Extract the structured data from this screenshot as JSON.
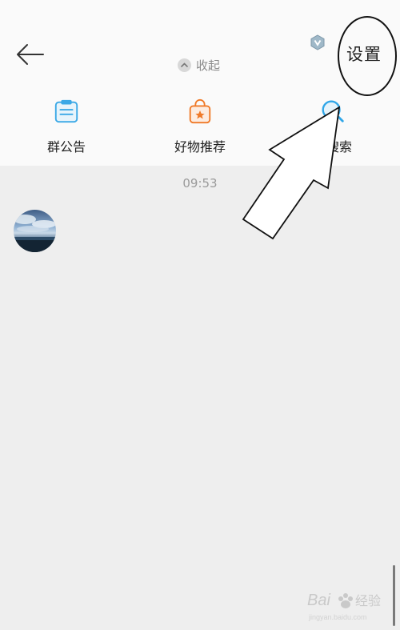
{
  "header": {
    "collapse_label": "收起",
    "settings_label": "设置"
  },
  "tools": [
    {
      "label": "群公告",
      "icon": "announcement-icon",
      "color": "#3aa8e6"
    },
    {
      "label": "好物推荐",
      "icon": "shopping-bag-icon",
      "color": "#f07a28"
    },
    {
      "label": "群搜索",
      "icon": "search-icon",
      "color": "#2fa6e8"
    }
  ],
  "chat": {
    "timestamp": "09:53"
  },
  "colors": {
    "annotation": "#111111",
    "panel_bg": "#fafafa",
    "chat_bg": "#eeeeee"
  },
  "watermark": {
    "text": "Baidu 经验",
    "subtext": "jingyan.baidu.com"
  }
}
